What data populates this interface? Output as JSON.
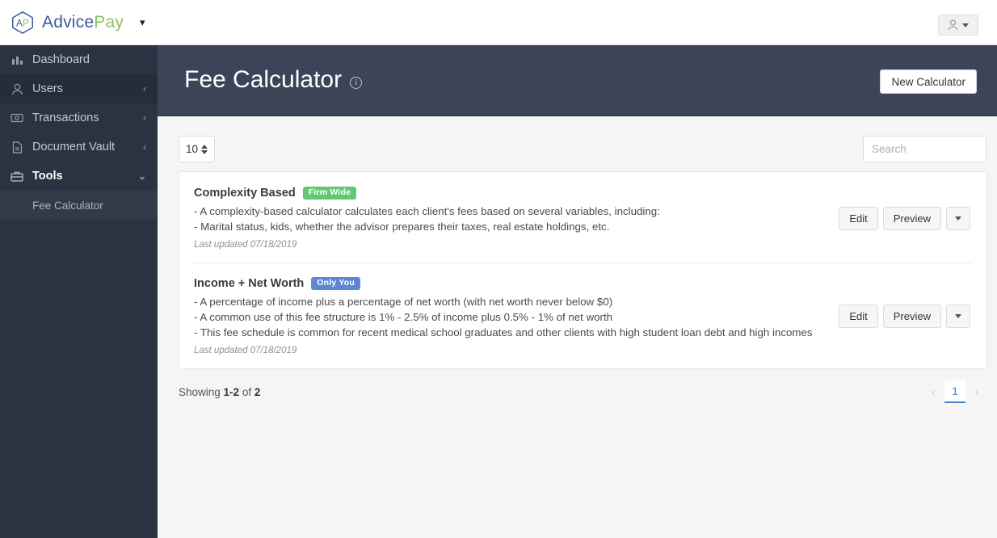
{
  "brand": {
    "mark_label": "AP",
    "name_part1": "Advice",
    "name_part2": "Pay",
    "caret": "▾"
  },
  "topbar": {
    "user_menu_caret": "▾"
  },
  "sidebar": {
    "items": [
      {
        "label": "Dashboard",
        "icon": "bar-chart-icon",
        "chevron": "",
        "state": "normal"
      },
      {
        "label": "Users",
        "icon": "person-icon",
        "chevron": "‹",
        "state": "active"
      },
      {
        "label": "Transactions",
        "icon": "money-icon",
        "chevron": "‹",
        "state": "normal"
      },
      {
        "label": "Document Vault",
        "icon": "document-icon",
        "chevron": "‹",
        "state": "normal"
      },
      {
        "label": "Tools",
        "icon": "briefcase-icon",
        "chevron": "⌄",
        "state": "bold"
      }
    ],
    "sub_items": [
      {
        "label": "Fee Calculator"
      }
    ]
  },
  "header": {
    "title": "Fee Calculator",
    "info_icon": "i",
    "new_calculator_label": "New Calculator"
  },
  "toolbar": {
    "page_size": "10",
    "search_placeholder": "Search"
  },
  "calculators": [
    {
      "title": "Complexity Based",
      "badge": "Firm Wide",
      "badge_color": "#63c874",
      "badge_style": "green",
      "lines": [
        "- A complexity-based calculator calculates each client's fees based on several variables, including:",
        "- Marital status, kids, whether the advisor prepares their taxes, real estate holdings, etc."
      ],
      "last_updated": "Last updated 07/18/2019",
      "edit_label": "Edit",
      "preview_label": "Preview"
    },
    {
      "title": "Income + Net Worth",
      "badge": "Only You",
      "badge_color": "#5d87d4",
      "badge_style": "blue",
      "lines": [
        "- A percentage of income plus a percentage of net worth (with net worth never below $0)",
        "- A common use of this fee structure is 1% - 2.5% of income plus 0.5% - 1% of net worth",
        "- This fee schedule is common for recent medical school graduates and other clients with high student loan debt and high incomes"
      ],
      "last_updated": "Last updated 07/18/2019",
      "edit_label": "Edit",
      "preview_label": "Preview"
    }
  ],
  "footer": {
    "showing_prefix": "Showing ",
    "showing_range": "1-2",
    "showing_middle": " of ",
    "showing_total": "2",
    "prev_arrow": "‹",
    "next_arrow": "›",
    "current_page": "1"
  }
}
